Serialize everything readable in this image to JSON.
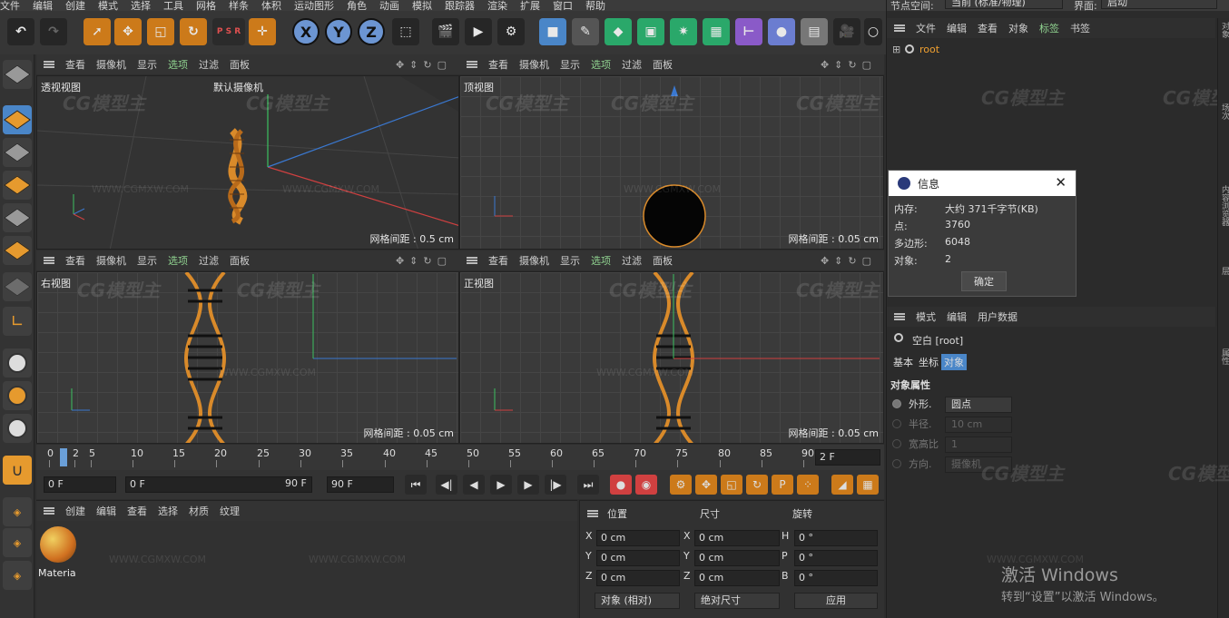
{
  "menu": [
    "文件",
    "编辑",
    "创建",
    "模式",
    "选择",
    "工具",
    "网格",
    "样条",
    "体积",
    "运动图形",
    "角色",
    "动画",
    "模拟",
    "跟踪器",
    "渲染",
    "扩展",
    "窗口",
    "帮助"
  ],
  "top_right": {
    "node_space_label": "节点空间:",
    "node_space_value": "当前 (标准/物理)",
    "layout_label": "界面:",
    "layout_value": "启动"
  },
  "toolbar": {
    "x": "X",
    "y": "Y",
    "z": "Z",
    "psr": "P S R"
  },
  "viewport_menu": [
    "查看",
    "摄像机",
    "显示",
    "选项",
    "过滤",
    "面板"
  ],
  "viewports": {
    "perspective": {
      "label": "透视视图",
      "camera": "默认摄像机 ",
      "grid": "网格间距 : 0.5 cm"
    },
    "top": {
      "label": "顶视图",
      "grid": "网格间距 : 0.05 cm"
    },
    "right": {
      "label": "右视图",
      "grid": "网格间距 : 0.05 cm"
    },
    "front": {
      "label": "正视图",
      "grid": "网格间距 : 0.05 cm"
    }
  },
  "watermark": {
    "logo": "CG模型主",
    "url": "WWW.CGMXW.COM"
  },
  "timeline": {
    "ticks": [
      "0",
      "2",
      "5",
      "10",
      "15",
      "20",
      "25",
      "30",
      "35",
      "40",
      "45",
      "50",
      "55",
      "60",
      "65",
      "70",
      "75",
      "80",
      "85",
      "90"
    ],
    "current_frame": "2 F"
  },
  "transport": {
    "start": "0 F",
    "min": "0 F",
    "max_a": "90 F",
    "max_b": "90 F"
  },
  "material_panel": {
    "menu": [
      "创建",
      "编辑",
      "查看",
      "选择",
      "材质",
      "纹理"
    ],
    "material_name": "Materia"
  },
  "coord_panel": {
    "headers": {
      "position": "位置",
      "size": "尺寸",
      "rotation": "旋转"
    },
    "rows": [
      {
        "axis": "X",
        "pos": "0 cm",
        "size_axis": "X",
        "size": "0 cm",
        "rot_axis": "H",
        "rot": "0 °"
      },
      {
        "axis": "Y",
        "pos": "0 cm",
        "size_axis": "Y",
        "size": "0 cm",
        "rot_axis": "P",
        "rot": "0 °"
      },
      {
        "axis": "Z",
        "pos": "0 cm",
        "size_axis": "Z",
        "size": "0 cm",
        "rot_axis": "B",
        "rot": "0 °"
      }
    ],
    "mode": "对象 (相对)",
    "size_mode": "绝对尺寸",
    "apply": "应用"
  },
  "object_manager": {
    "menu": [
      "文件",
      "编辑",
      "查看",
      "对象",
      "标签",
      "书签"
    ],
    "root": "root"
  },
  "info_dialog": {
    "title": "信息",
    "rows": [
      {
        "label": "内存:",
        "value": "大约 371千字节(KB)"
      },
      {
        "label": "点:",
        "value": "3760"
      },
      {
        "label": "多边形:",
        "value": "6048"
      },
      {
        "label": "对象:",
        "value": "2"
      }
    ],
    "ok": "确定"
  },
  "attributes": {
    "menu": [
      "模式",
      "编辑",
      "用户数据"
    ],
    "object": "空白 [root]",
    "tabs": [
      "基本",
      "坐标",
      "对象"
    ],
    "section": "对象属性",
    "props": [
      {
        "label": "外形.",
        "value": "圆点"
      },
      {
        "label": "半径.",
        "value": "10 cm"
      },
      {
        "label": "宽高比",
        "value": "1"
      },
      {
        "label": "方向.",
        "value": "摄像机"
      }
    ]
  },
  "side_tabs": [
    "对象",
    "场次",
    "内容浏览器",
    "层",
    "属性"
  ],
  "activation": {
    "title": "激活 Windows",
    "subtitle": "转到“设置”以激活 Windows。"
  }
}
